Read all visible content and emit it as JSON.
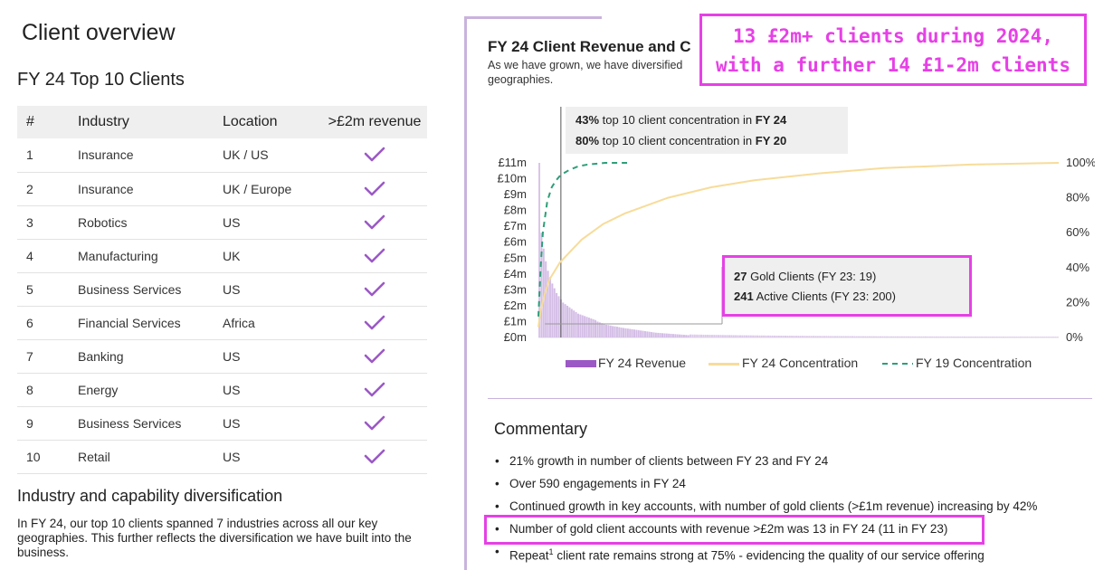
{
  "left": {
    "title": "Client overview",
    "section_title": "FY 24 Top 10 Clients",
    "table": {
      "headers": [
        "#",
        "Industry",
        "Location",
        ">£2m revenue"
      ],
      "rows": [
        [
          "1",
          "Insurance",
          "UK / US"
        ],
        [
          "2",
          "Insurance",
          "UK / Europe"
        ],
        [
          "3",
          "Robotics",
          "US"
        ],
        [
          "4",
          "Manufacturing",
          "UK"
        ],
        [
          "5",
          "Business Services",
          "US"
        ],
        [
          "6",
          "Financial Services",
          "Africa"
        ],
        [
          "7",
          "Banking",
          "US"
        ],
        [
          "8",
          "Energy",
          "US"
        ],
        [
          "9",
          "Business Services",
          "US"
        ],
        [
          "10",
          "Retail",
          "US"
        ]
      ],
      "check_icon": "checkmark-icon"
    },
    "diversification_title": "Industry and capability diversification",
    "diversification_text": "In FY 24, our top 10 clients spanned 7 industries across all our key geographies. This further reflects the diversification we have built into the business."
  },
  "right": {
    "chart_title": "FY 24 Client Revenue and C",
    "chart_subtitle": "As we have grown, we have diversified geographies.",
    "callout": {
      "line1": "13 £2m+ clients during 2024,",
      "line2": "with a further 14 £1-2m clients"
    },
    "concentration_box": {
      "line1_bold": "43%",
      "line1_text": " top 10 client concentration in ",
      "line1_year": "FY 24",
      "line2_bold": "80%",
      "line2_text": " top 10 client concentration in ",
      "line2_year": "FY 20"
    },
    "gold_box": {
      "line1_bold": "27",
      "line1_text": " Gold Clients (FY 23: 19)",
      "line2_bold": "241",
      "line2_text": " Active Clients (FY 23: 200)"
    },
    "commentary_title": "Commentary",
    "bullets": [
      "21% growth in number of clients between FY 23 and FY 24",
      "Over 590 engagements in FY 24",
      "Continued growth in key accounts, with number of gold clients (>£1m revenue) increasing by 42%",
      "Number of gold client accounts with revenue >£2m was 13 in FY 24 (11 in FY 23)"
    ],
    "bullet5_pre": "Repeat",
    "bullet5_sup": "1",
    "bullet5_post": " client rate remains strong at 75% - evidencing the quality of our service offering"
  },
  "colors": {
    "accent_pink": "#e640e6",
    "revenue_purple": "#9b59c6",
    "concentration_yellow": "#f7dc9a",
    "fy19_green": "#2e9e7a",
    "check_purple": "#9b59c6"
  },
  "chart_data": {
    "type": "bar",
    "title": "FY 24 Client Revenue and C",
    "y_left_ticks": [
      "£0m",
      "£1m",
      "£2m",
      "£3m",
      "£4m",
      "£5m",
      "£6m",
      "£7m",
      "£8m",
      "£9m",
      "£10m",
      "£11m"
    ],
    "y_right_ticks": [
      "0%",
      "20%",
      "40%",
      "60%",
      "80%",
      "100%"
    ],
    "ylim_left": [
      0,
      11
    ],
    "ylim_right": [
      0,
      100
    ],
    "x_clients": 241,
    "legend_position": "bottom",
    "series": [
      {
        "name": "FY 24 Revenue",
        "kind": "bar",
        "axis": "left",
        "values": [
          11.0,
          6.6,
          5.6,
          4.8,
          4.2,
          3.8,
          3.4,
          3.1,
          2.8,
          2.6,
          2.4,
          2.2,
          2.1,
          2.0,
          1.9,
          1.8,
          1.7,
          1.6,
          1.5,
          1.45,
          1.4,
          1.35,
          1.3,
          1.25,
          1.2,
          1.15,
          1.1,
          1.0,
          0.95,
          0.9,
          0.85,
          0.8,
          0.78,
          0.75,
          0.72,
          0.7,
          0.68,
          0.65,
          0.62,
          0.6,
          0.58,
          0.56,
          0.54,
          0.52,
          0.5,
          0.48,
          0.46,
          0.44,
          0.42,
          0.4,
          0.38,
          0.36,
          0.34,
          0.32,
          0.3,
          0.29,
          0.28,
          0.27,
          0.26,
          0.25,
          0.24,
          0.23,
          0.22,
          0.21,
          0.2,
          0.19,
          0.18,
          0.17,
          0.16,
          0.15
        ]
      },
      {
        "name": "FY 24 Concentration",
        "kind": "line",
        "axis": "right",
        "x": [
          0,
          1,
          3,
          5,
          10,
          20,
          30,
          40,
          60,
          80,
          100,
          130,
          160,
          200,
          241
        ],
        "values": [
          6,
          15,
          25,
          33,
          43,
          56,
          65,
          71,
          80,
          86,
          90,
          94,
          97,
          99,
          100
        ]
      },
      {
        "name": "FY 19 Concentration",
        "kind": "dashed-line",
        "axis": "right",
        "x": [
          0,
          1,
          2,
          4,
          6,
          8,
          10,
          14,
          18,
          22,
          26,
          30,
          35,
          40
        ],
        "values": [
          12,
          40,
          60,
          78,
          86,
          90,
          93,
          96,
          98,
          99,
          99.5,
          100,
          100,
          100
        ]
      }
    ]
  }
}
